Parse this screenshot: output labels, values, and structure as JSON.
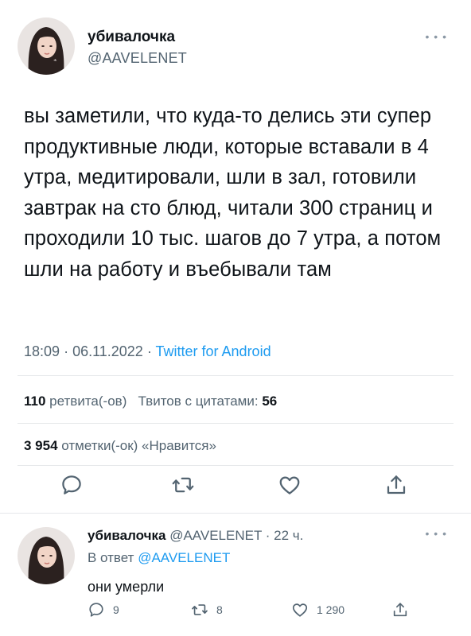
{
  "tweet": {
    "display_name": "убивалочка",
    "handle": "@AAVELENET",
    "text": "вы заметили, что куда-то делись эти супер продуктивные люди, которые вставали в 4 утра, медитировали, шли в зал, готовили завтрак на сто блюд, читали 300 страниц и проходили 10 тыс. шагов до 7 утра, а потом шли на работу и въебывали там",
    "time": "18:09",
    "date": "06.11.2022",
    "source": "Twitter for Android",
    "retweets_count": "110",
    "retweets_label": "ретвита(-ов)",
    "quotes_label": "Твитов с цитатами:",
    "quotes_count": "56",
    "likes_count": "3 954",
    "likes_label": "отметки(-ок) «Нравится»",
    "more_icon": "more-dots-icon",
    "actions": [
      "reply-icon",
      "retweet-icon",
      "like-icon",
      "share-icon"
    ]
  },
  "reply": {
    "display_name": "убивалочка",
    "handle": "@AAVELENET",
    "time_ago": "· 22 ч.",
    "reply_to_label": "В ответ",
    "reply_to_handle": "@AAVELENET",
    "text": "они умерли",
    "reply_count": "9",
    "retweet_count": "8",
    "like_count": "1 290"
  },
  "colors": {
    "text_primary": "#0f1419",
    "text_secondary": "#536471",
    "accent": "#1d9bf0",
    "divider": "#e6e8ea"
  }
}
